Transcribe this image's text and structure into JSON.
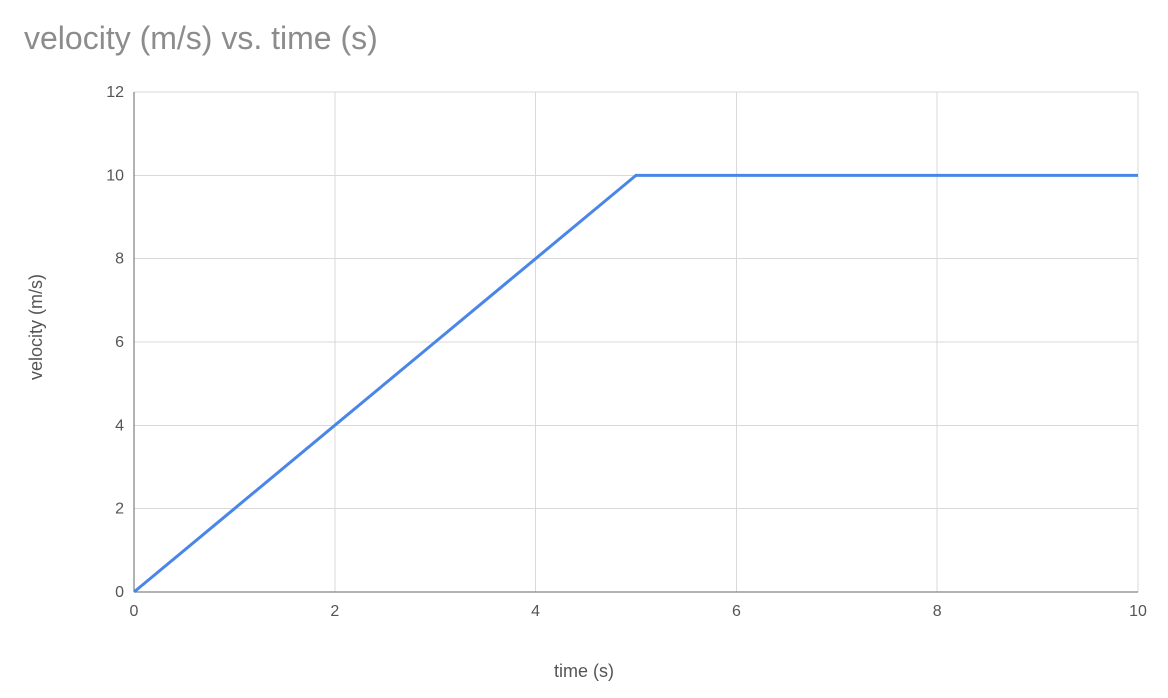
{
  "chart_data": {
    "type": "line",
    "title": "velocity (m/s) vs. time (s)",
    "xlabel": "time (s)",
    "ylabel": "velocity (m/s)",
    "xlim": [
      0,
      10
    ],
    "ylim": [
      0,
      12
    ],
    "x_ticks": [
      0,
      2,
      4,
      6,
      8,
      10
    ],
    "y_ticks": [
      0,
      2,
      4,
      6,
      8,
      10,
      12
    ],
    "x": [
      0,
      1,
      2,
      3,
      4,
      5,
      6,
      7,
      8,
      9,
      10
    ],
    "values": [
      0,
      2,
      4,
      6,
      8,
      10,
      10,
      10,
      10,
      10,
      10
    ],
    "grid": true,
    "line_color": "#4a86e8"
  }
}
